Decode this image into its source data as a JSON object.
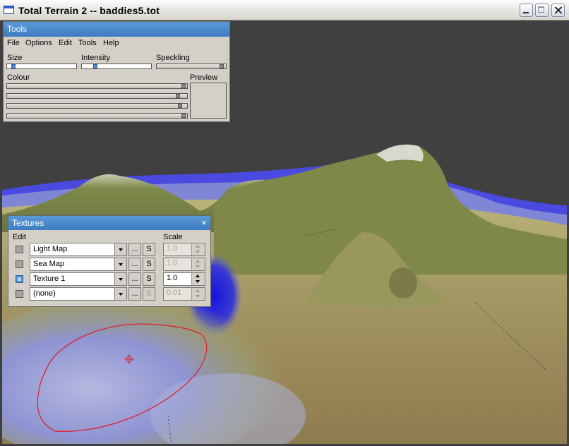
{
  "window": {
    "title": "Total Terrain 2 -- baddies5.tot",
    "icon": "window-icon"
  },
  "tools_panel": {
    "title": "Tools",
    "menu": [
      "File",
      "Options",
      "Edit",
      "Tools",
      "Help"
    ],
    "size_label": "Size",
    "intensity_label": "Intensity",
    "speckling_label": "Speckling",
    "colour_label": "Colour",
    "preview_label": "Preview",
    "size_level": 0.06,
    "intensity_level": 0.17,
    "speckling_level": 0.97,
    "colour_levels": [
      0.99,
      0.96,
      0.97,
      0.99
    ]
  },
  "textures_panel": {
    "title": "Textures",
    "close_glyph": "×",
    "edit_header": "Edit",
    "scale_header": "Scale",
    "browse_label": "...",
    "s_label": "S",
    "rows": [
      {
        "name": "Light Map",
        "checked": false,
        "scale": "1.0",
        "enabled": false
      },
      {
        "name": "Sea Map",
        "checked": false,
        "scale": "1.0",
        "enabled": false
      },
      {
        "name": "Texture 1",
        "checked": true,
        "scale": "1.0",
        "enabled": true
      },
      {
        "name": "(none)",
        "checked": false,
        "scale": "0.01",
        "enabled": false
      }
    ]
  },
  "colors": {
    "panel_header": "#3d7cc0",
    "panel_bg": "#d4d0c8",
    "brush_outline": "#e0202a",
    "sea": "#2a2ad8",
    "sky": "#404040"
  }
}
